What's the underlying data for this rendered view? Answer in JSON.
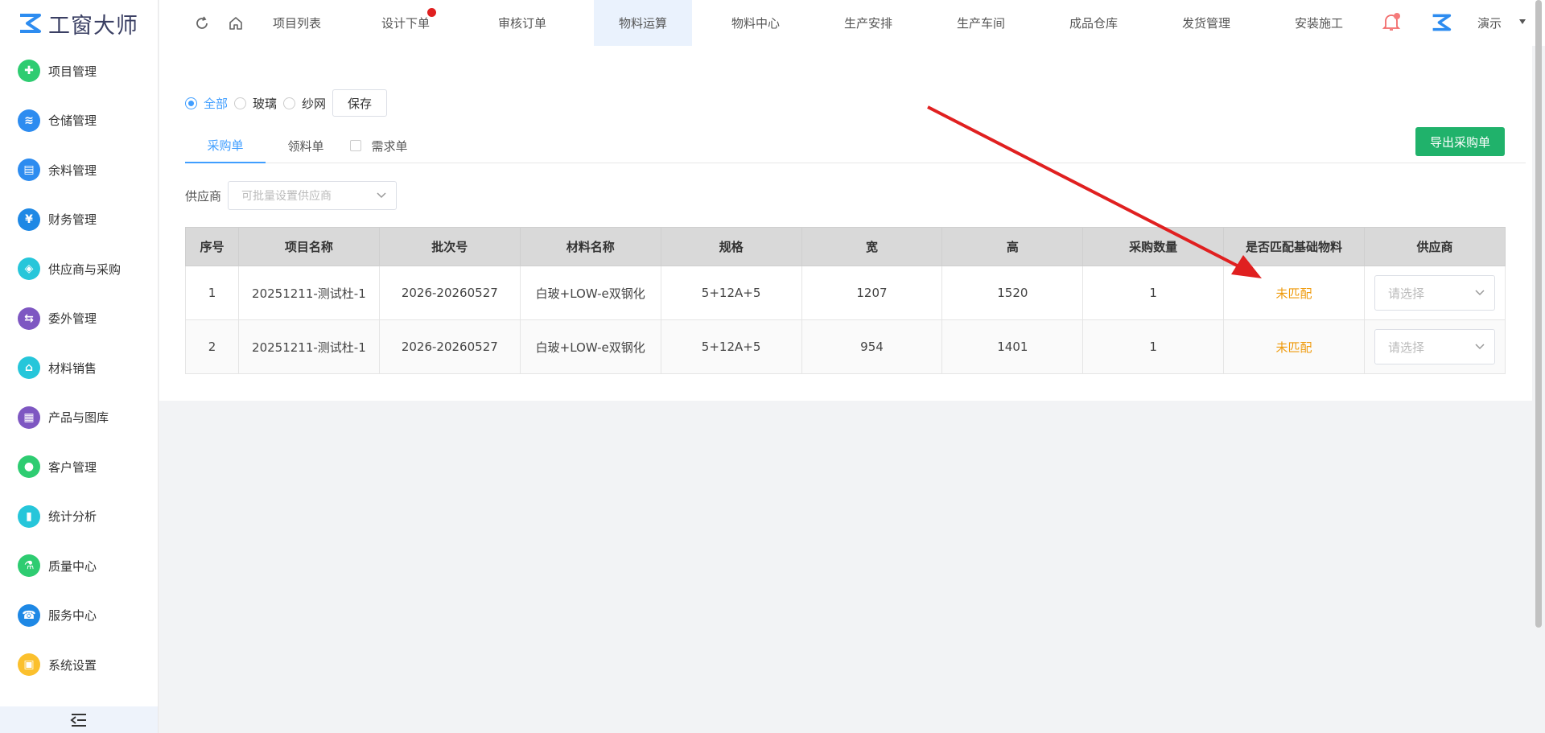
{
  "app": {
    "logo_text": "工窗大师",
    "brand_color": "#3a3f63"
  },
  "sidebar": {
    "items": [
      {
        "label": "项目管理",
        "icon": "puzzle-icon",
        "color": "#2ecc71"
      },
      {
        "label": "仓储管理",
        "icon": "layers-icon",
        "color": "#2d8cf0"
      },
      {
        "label": "余料管理",
        "icon": "document-icon",
        "color": "#2d8cf0"
      },
      {
        "label": "财务管理",
        "icon": "finance-icon",
        "color": "#1e88e5"
      },
      {
        "label": "供应商与采购",
        "icon": "shield-icon",
        "color": "#26c6da"
      },
      {
        "label": "委外管理",
        "icon": "outsource-icon",
        "color": "#7e57c2"
      },
      {
        "label": "材料销售",
        "icon": "sales-icon",
        "color": "#26c6da"
      },
      {
        "label": "产品与图库",
        "icon": "box-icon",
        "color": "#7e57c2"
      },
      {
        "label": "客户管理",
        "icon": "user-icon",
        "color": "#2ecc71"
      },
      {
        "label": "统计分析",
        "icon": "chart-icon",
        "color": "#26c6da"
      },
      {
        "label": "质量中心",
        "icon": "flask-icon",
        "color": "#2ecc71"
      },
      {
        "label": "服务中心",
        "icon": "phone-icon",
        "color": "#1e88e5"
      },
      {
        "label": "系统设置",
        "icon": "settings-icon",
        "color": "#fbc02d"
      }
    ]
  },
  "topnav": {
    "tabs": [
      {
        "label": "项目列表"
      },
      {
        "label": "设计下单",
        "dot": true
      },
      {
        "label": "审核订单"
      },
      {
        "label": "物料运算",
        "active": true
      },
      {
        "label": "物料中心"
      },
      {
        "label": "生产安排"
      },
      {
        "label": "生产车间"
      },
      {
        "label": "成品仓库"
      },
      {
        "label": "发货管理"
      },
      {
        "label": "安装施工"
      }
    ],
    "user_name": "演示"
  },
  "filter": {
    "radios": [
      {
        "label": "全部",
        "checked": true
      },
      {
        "label": "玻璃",
        "checked": false
      },
      {
        "label": "纱网",
        "checked": false
      }
    ],
    "save_label": "保存"
  },
  "tabs": [
    {
      "label": "采购单",
      "active": true
    },
    {
      "label": "领料单"
    },
    {
      "label": "需求单",
      "checkbox": true
    }
  ],
  "export_label": "导出采购单",
  "supplier": {
    "label": "供应商",
    "placeholder": "可批量设置供应商"
  },
  "table": {
    "headers": [
      "序号",
      "项目名称",
      "批次号",
      "材料名称",
      "规格",
      "宽",
      "高",
      "采购数量",
      "是否匹配基础物料",
      "供应商"
    ],
    "rows": [
      {
        "no": "1",
        "project": "20251211-测试杜-1",
        "batch": "2026-20260527",
        "material": "白玻+LOW-e双钢化",
        "spec": "5+12A+5",
        "width": "1207",
        "height": "1520",
        "qty": "1",
        "match": "未匹配",
        "supplier_placeholder": "请选择"
      },
      {
        "no": "2",
        "project": "20251211-测试杜-1",
        "batch": "2026-20260527",
        "material": "白玻+LOW-e双钢化",
        "spec": "5+12A+5",
        "width": "954",
        "height": "1401",
        "qty": "1",
        "match": "未匹配",
        "supplier_placeholder": "请选择"
      }
    ]
  },
  "colors": {
    "primary": "#409eff",
    "success": "#20b26b",
    "warning": "#ef9a0b",
    "annotation": "#e02020"
  }
}
